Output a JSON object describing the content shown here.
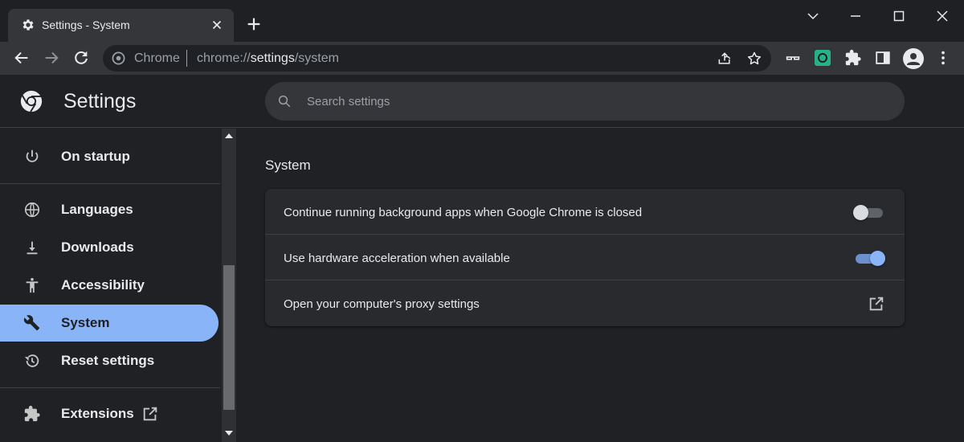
{
  "tab": {
    "title": "Settings - System",
    "icon": "gear-icon"
  },
  "omnibox": {
    "chip": "Chrome",
    "url_prefix": "chrome://",
    "url_host": "settings",
    "url_path": "/system"
  },
  "header": {
    "title": "Settings",
    "search_placeholder": "Search settings"
  },
  "sidebar": {
    "items": [
      {
        "label": "On startup",
        "icon": "power-icon"
      },
      {
        "label": "Languages",
        "icon": "globe-icon"
      },
      {
        "label": "Downloads",
        "icon": "download-icon"
      },
      {
        "label": "Accessibility",
        "icon": "accessibility-icon"
      },
      {
        "label": "System",
        "icon": "wrench-icon",
        "active": true
      },
      {
        "label": "Reset settings",
        "icon": "history-icon"
      },
      {
        "label": "Extensions",
        "icon": "puzzle-icon"
      }
    ]
  },
  "main": {
    "section_title": "System",
    "rows": [
      {
        "label": "Continue running background apps when Google Chrome is closed",
        "toggle": false
      },
      {
        "label": "Use hardware acceleration when available",
        "toggle": true
      },
      {
        "label": "Open your computer's proxy settings",
        "control": "external-link-icon"
      }
    ]
  },
  "colors": {
    "accent": "#8ab4f8",
    "background": "#202124",
    "surface": "#292a2d",
    "toolbar": "#35363a"
  }
}
